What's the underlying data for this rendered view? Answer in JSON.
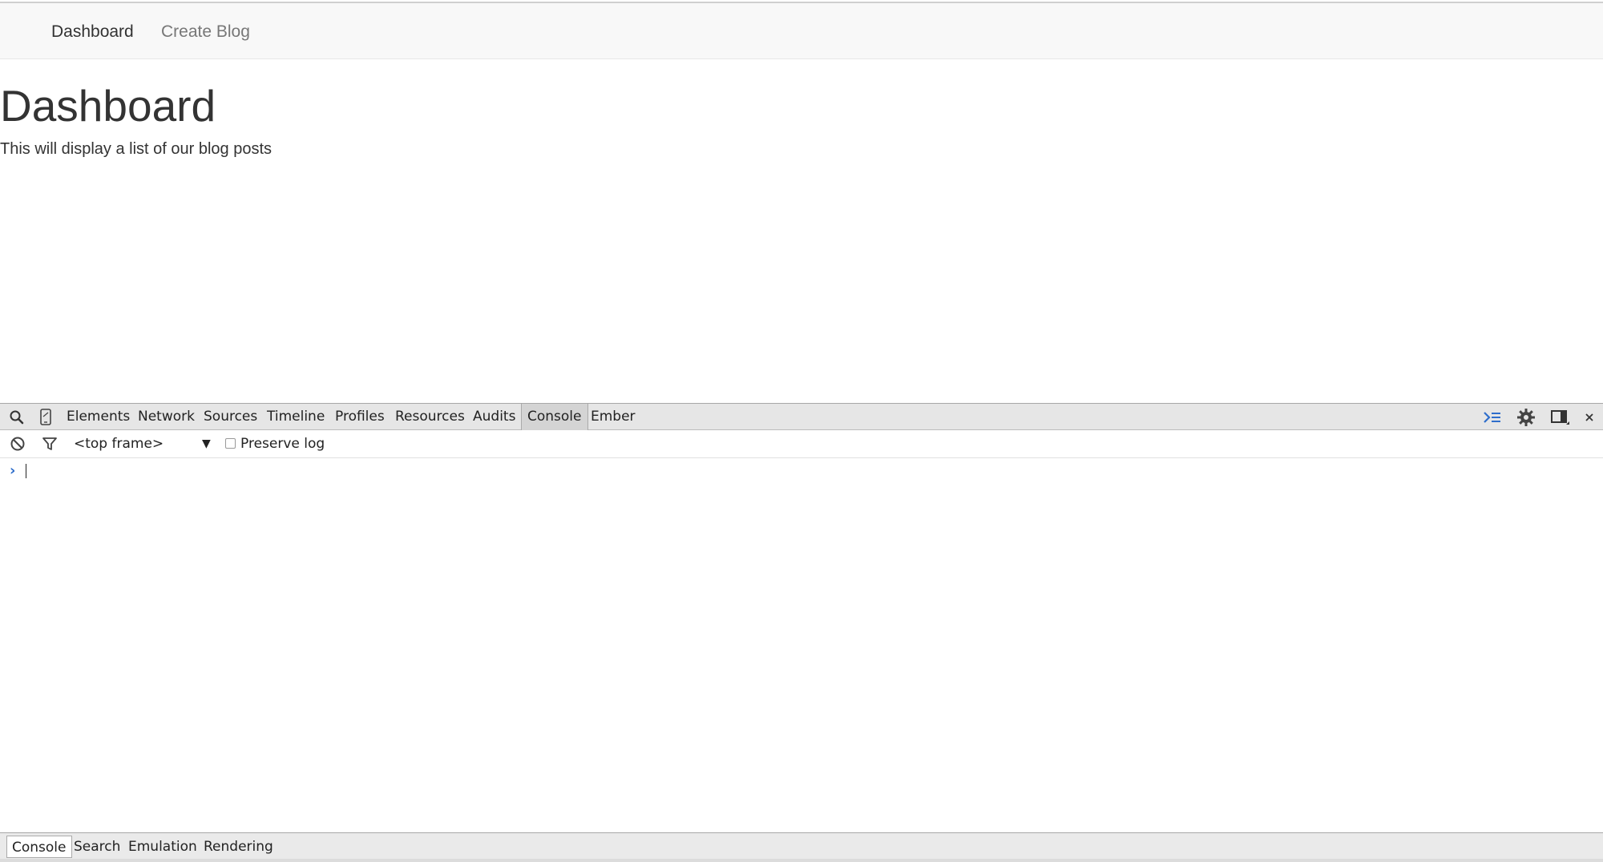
{
  "navbar": {
    "items": [
      {
        "label": "Dashboard",
        "active": true
      },
      {
        "label": "Create Blog",
        "active": false
      }
    ]
  },
  "page": {
    "title": "Dashboard",
    "description": "This will display a list of our blog posts"
  },
  "devtools": {
    "tabs": [
      "Elements",
      "Network",
      "Sources",
      "Timeline",
      "Profiles",
      "Resources",
      "Audits",
      "Console",
      "Ember"
    ],
    "selected_tab": "Console",
    "toolbar_icons": [
      "search-icon",
      "device-mode-icon",
      "console-drawer-icon",
      "gear-icon",
      "dock-side-icon",
      "close-icon"
    ],
    "console_bar": {
      "icons": [
        "clear-console-icon",
        "filter-icon"
      ],
      "frame_selector": "<top frame>",
      "preserve_log_label": "Preserve log",
      "preserve_log_checked": false
    },
    "prompt": {
      "symbol": "›",
      "value": ""
    },
    "drawer_tabs": [
      "Console",
      "Search",
      "Emulation",
      "Rendering"
    ],
    "selected_drawer_tab": "Console",
    "colors": {
      "accent": "#2f6ecb",
      "toolbar_bg": "#e6e6e6"
    }
  }
}
